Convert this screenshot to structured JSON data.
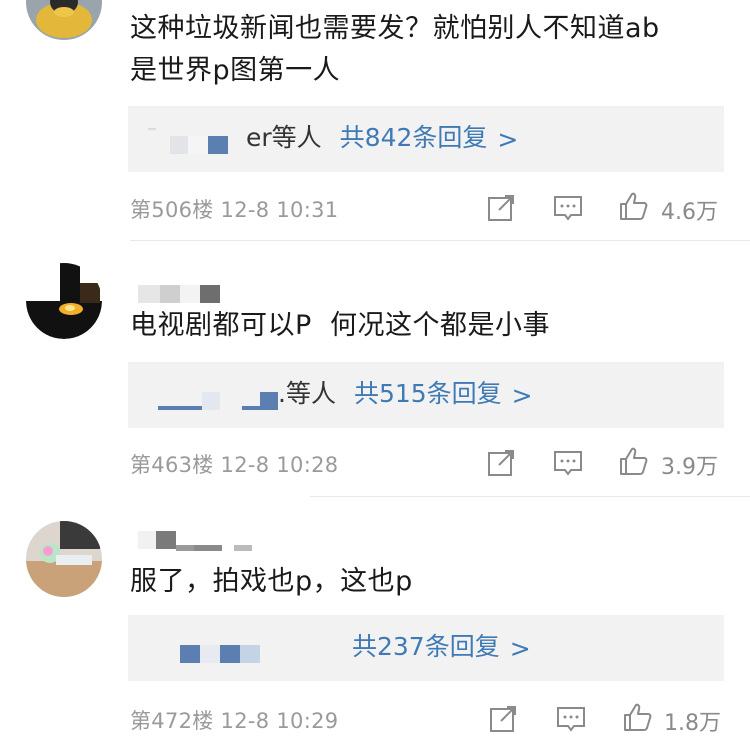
{
  "comments": [
    {
      "text": "这种垃圾新闻也需要发？就怕别人不知道ab\n是世界p图第一人",
      "reply_names_suffix": "er等人",
      "reply_count_label": "共842条回复",
      "meta": "第506楼 12-8 10:31",
      "likes": "4.6万"
    },
    {
      "text": "电视剧都可以P  何况这个都是小事",
      "reply_names_suffix": ".等人",
      "reply_count_label": "共515条回复",
      "meta": "第463楼 12-8 10:28",
      "likes": "3.9万"
    },
    {
      "text": "服了，拍戏也p，这也p",
      "reply_names_suffix": "",
      "reply_count_label": "共237条回复",
      "meta": "第472楼 12-8 10:29",
      "likes": "1.8万"
    }
  ],
  "chevron": ">",
  "icons": {
    "share": "share-icon",
    "comment": "comment-icon",
    "like": "like-icon"
  },
  "colors": {
    "link_blue": "#3f7ab5",
    "meta_gray": "#9a9a9a",
    "reply_bg": "#f2f2f3"
  }
}
